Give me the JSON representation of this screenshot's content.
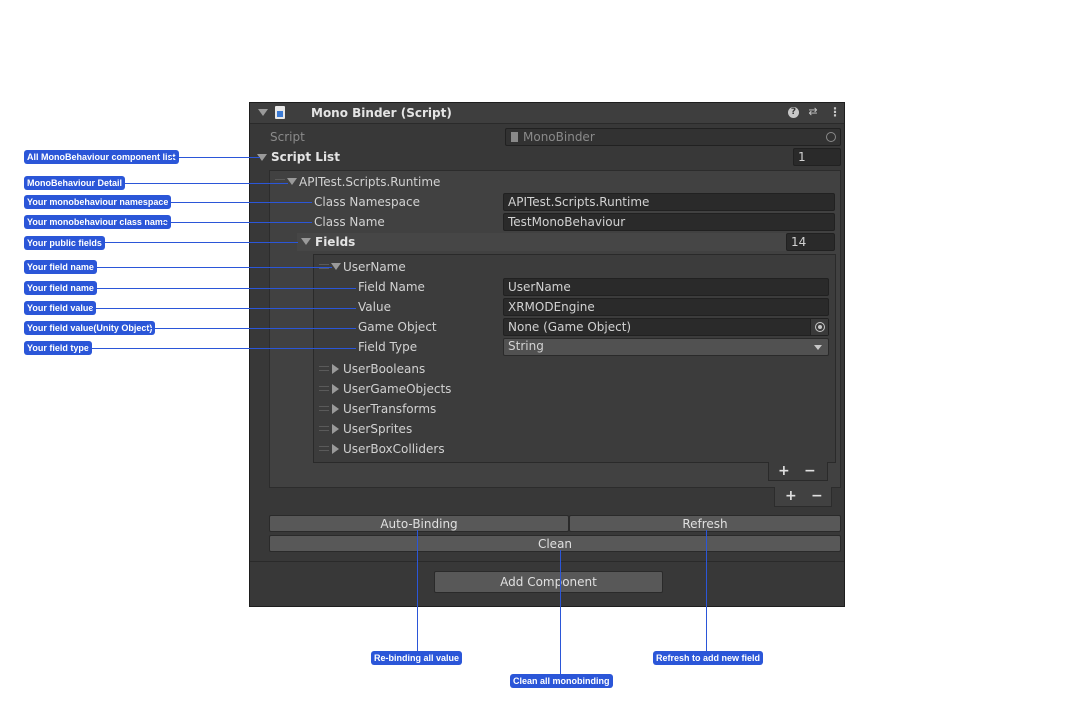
{
  "inspector": {
    "title": "Mono Binder (Script)",
    "script_label": "Script",
    "script_value": "MonoBinder",
    "script_list_label": "Script List",
    "script_list_count": "1",
    "element": {
      "title": "APITest.Scripts.Runtime",
      "namespace_label": "Class Namespace",
      "namespace_value": "APITest.Scripts.Runtime",
      "classname_label": "Class Name",
      "classname_value": "TestMonoBehaviour",
      "fields_label": "Fields",
      "fields_count": "14",
      "field": {
        "title": "UserName",
        "field_name_label": "Field Name",
        "field_name_value": "UserName",
        "value_label": "Value",
        "value_value": "XRMODEngine",
        "gameobject_label": "Game Object",
        "gameobject_value": "None (Game Object)",
        "fieldtype_label": "Field Type",
        "fieldtype_value": "String"
      },
      "collapsed_fields": [
        "UserBooleans",
        "UserGameObjects",
        "UserTransforms",
        "UserSprites",
        "UserBoxColliders"
      ]
    },
    "plus": "+",
    "minus": "−",
    "auto_binding": "Auto-Binding",
    "refresh": "Refresh",
    "clean": "Clean",
    "add_component": "Add Component"
  },
  "annotations": {
    "component_list": "All MonoBehaviour component list",
    "detail": "MonoBehaviour Detail",
    "namespace": "Your monobehaviour namespace",
    "classname": "Your monobehaviour class name",
    "public_fields": "Your public fields",
    "field_name_1": "Your field name",
    "field_name_2": "Your field name",
    "field_value": "Your field value",
    "field_value_obj": "Your field value(Unity Object)",
    "field_type": "Your field type",
    "rebinding": "Re-binding all value",
    "clean_all": "Clean all monobinding",
    "refresh_add": "Refresh to add new field"
  },
  "colors": {
    "accent": "#2b56d8",
    "inspector_bg": "#383838"
  }
}
